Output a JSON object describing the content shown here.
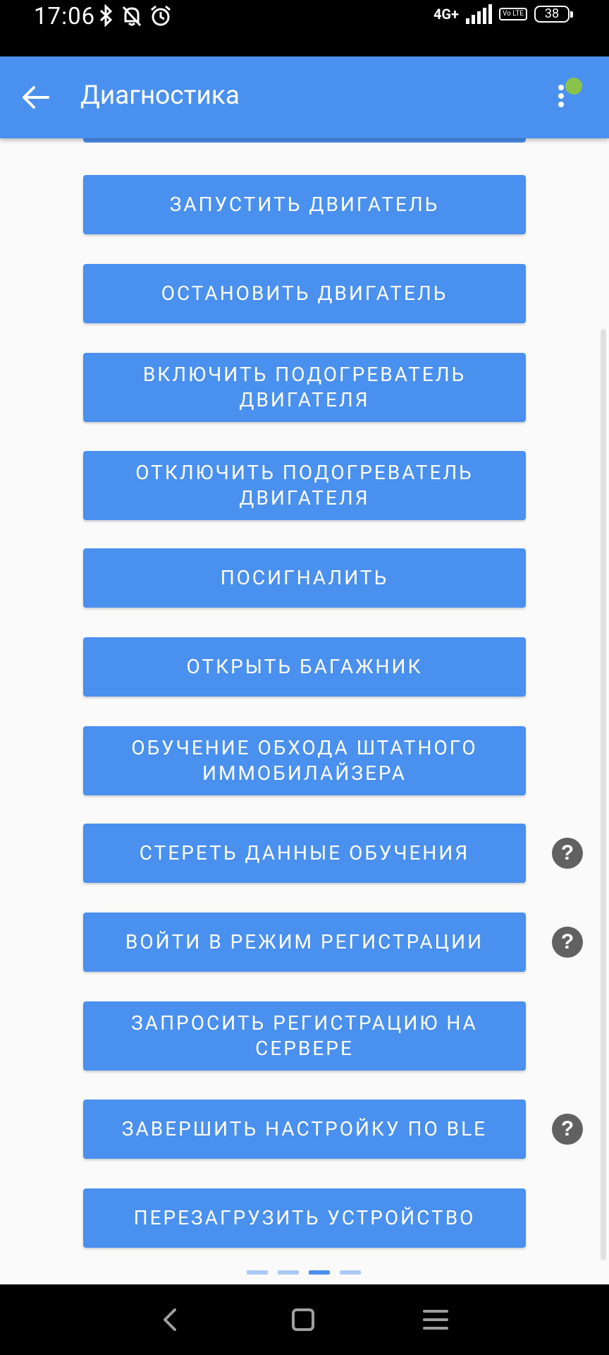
{
  "status_bar": {
    "time": "17:06",
    "network": "4G+",
    "volte": "Vo LTE",
    "battery": "38",
    "icons": [
      "bluetooth-icon",
      "bell-off-icon",
      "alarm-icon",
      "signal-icon"
    ]
  },
  "app_bar": {
    "title": "Диагностика",
    "back_icon": "arrow-back-icon",
    "menu_icon": "more-vert-icon",
    "connection_color": "#8bc34a"
  },
  "buttons": [
    {
      "label": "Запустить двигатель",
      "help": false
    },
    {
      "label": "Остановить двигатель",
      "help": false
    },
    {
      "label": "Включить подогреватель двигателя",
      "help": false
    },
    {
      "label": "Отключить подогреватель двигателя",
      "help": false
    },
    {
      "label": "Посигналить",
      "help": false
    },
    {
      "label": "Открыть багажник",
      "help": false
    },
    {
      "label": "Обучение обхода штатного иммобилайзера",
      "help": false
    },
    {
      "label": "Стереть данные обучения",
      "help": true
    },
    {
      "label": "Войти в режим регистрации",
      "help": true
    },
    {
      "label": "Запросить регистрацию на сервере",
      "help": false
    },
    {
      "label": "Завершить настройку по BLE",
      "help": true
    },
    {
      "label": "Перезагрузить устройство",
      "help": false
    }
  ],
  "help_glyph": "?",
  "pager": {
    "pages": 4,
    "active": 3
  },
  "colors": {
    "accent": "#4a90ee",
    "help": "#616161"
  },
  "nav_bar": {
    "icons": [
      "nav-back-icon",
      "nav-home-icon",
      "nav-menu-icon"
    ]
  }
}
